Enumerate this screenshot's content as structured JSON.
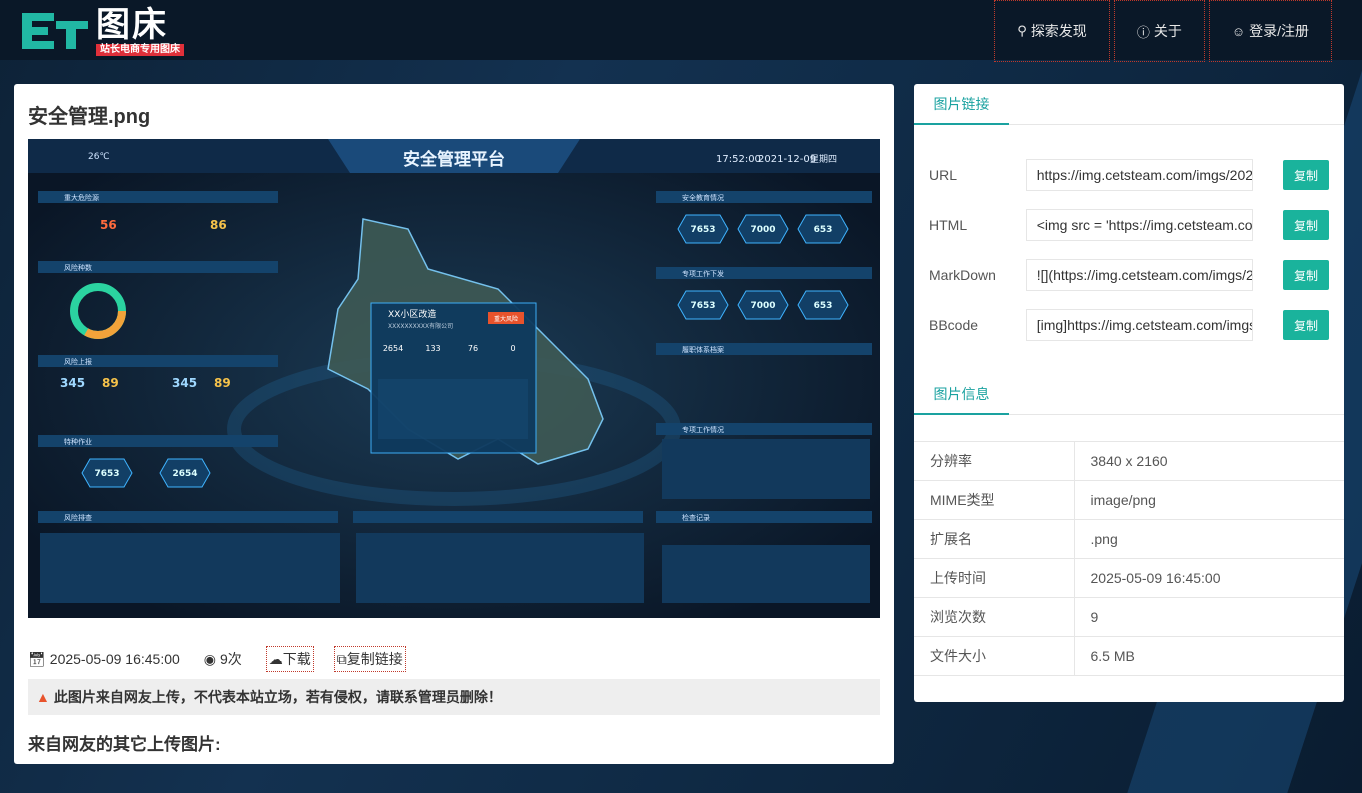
{
  "header": {
    "logo_title": "图床",
    "logo_subtitle": "站长电商专用图床",
    "nav": [
      {
        "icon": "search-icon",
        "label": "探索发现"
      },
      {
        "icon": "info-icon",
        "label": "关于"
      },
      {
        "icon": "user-icon",
        "label": "登录/注册"
      }
    ]
  },
  "image": {
    "title": "安全管理.png",
    "upload_time": "2025-05-09 16:45:00",
    "views": "9次",
    "download_label": "下载",
    "copy_link_label": "复制链接",
    "warning": "此图片来自网友上传，不代表本站立场，若有侵权，请联系管理员删除！",
    "others_heading": "来自网友的其它上传图片:"
  },
  "preview": {
    "platform_title": "安全管理平台",
    "weather": "26℃",
    "time": "17:52:00",
    "date": "2021-12-09",
    "weekday": "星期四",
    "popup_title": "XX小区改造",
    "popup_sub": "XXXXXXXXXX有限公司",
    "popup_badge": "重大风险",
    "popup_stats": [
      "2654",
      "133",
      "76",
      "0"
    ],
    "left_sections": [
      "重大危险源",
      "风险种数",
      "风险上报",
      "特种作业",
      "风险排查"
    ],
    "right_sections": [
      "安全教育情况",
      "专项工作下发",
      "履职体系档案",
      "专项工作情况",
      "检查记录"
    ],
    "numbers": {
      "a": "56",
      "b": "86",
      "c": "345",
      "d": "89",
      "e": "345",
      "f": "89",
      "g": "7653",
      "h": "2654",
      "i": "7653",
      "j": "7000",
      "k": "653",
      "l": "7653",
      "m": "7000",
      "n": "653"
    }
  },
  "links": {
    "tab_label": "图片链接",
    "copy_label": "复制",
    "rows": [
      {
        "label": "URL",
        "value": "https://img.cetsteam.com/imgs/202"
      },
      {
        "label": "HTML",
        "value": "<img src = 'https://img.cetsteam.co"
      },
      {
        "label": "MarkDown",
        "value": "![](https://img.cetsteam.com/imgs/2"
      },
      {
        "label": "BBcode",
        "value": "[img]https://img.cetsteam.com/imgs"
      }
    ]
  },
  "info": {
    "tab_label": "图片信息",
    "rows": [
      {
        "key": "分辨率",
        "value": "3840 x 2160"
      },
      {
        "key": "MIME类型",
        "value": "image/png"
      },
      {
        "key": "扩展名",
        "value": ".png"
      },
      {
        "key": "上传时间",
        "value": "2025-05-09 16:45:00"
      },
      {
        "key": "浏览次数",
        "value": "9"
      },
      {
        "key": "文件大小",
        "value": "6.5 MB"
      }
    ]
  },
  "colors": {
    "accent": "#1ab39c",
    "tab": "#1aa2a0",
    "warn": "#e8532c"
  }
}
